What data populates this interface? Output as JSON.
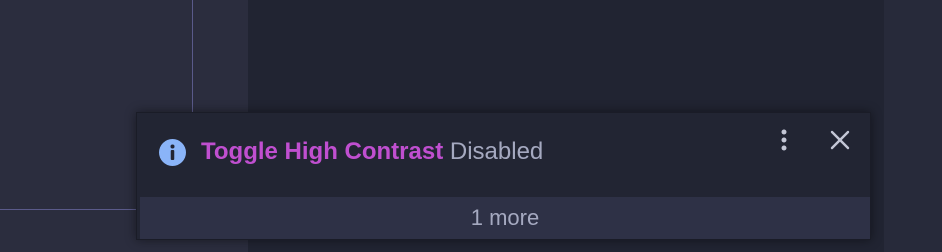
{
  "notification": {
    "icon": "info-icon",
    "command_name": "Toggle High Contrast",
    "status_text": "Disabled",
    "more_actions_icon": "kebab-menu-icon",
    "close_icon": "close-icon",
    "more_count_label": "1 more"
  },
  "colors": {
    "accent": "#c04fd0",
    "info_icon": "#8ab4f8",
    "text_muted": "#a5a9c0",
    "toast_bg": "#222533",
    "footer_bg": "#2e3146"
  }
}
